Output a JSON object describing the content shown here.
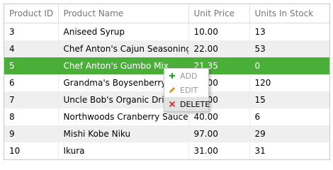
{
  "grid": {
    "columns": [
      "Product ID",
      "Product Name",
      "Unit Price",
      "Units In Stock"
    ],
    "rows": [
      [
        "3",
        "Aniseed Syrup",
        "10.00",
        "13"
      ],
      [
        "4",
        "Chef Anton's Cajun Seasoning",
        "22.00",
        "53"
      ],
      [
        "5",
        "Chef Anton's Gumbo Mix",
        "21.35",
        "0"
      ],
      [
        "6",
        "Grandma's Boysenberry Spread",
        "25.00",
        "120"
      ],
      [
        "7",
        "Uncle Bob's Organic Dried Pears",
        "30.00",
        "15"
      ],
      [
        "8",
        "Northwoods Cranberry Sauce",
        "40.00",
        "6"
      ],
      [
        "9",
        "Mishi Kobe Niku",
        "97.00",
        "29"
      ],
      [
        "10",
        "Ikura",
        "31.00",
        "31"
      ]
    ],
    "selected_row": 2
  },
  "context_menu": {
    "items": [
      {
        "label": "ADD",
        "icon": "plus-icon",
        "color": "#2e9e2e"
      },
      {
        "label": "EDIT",
        "icon": "pencil-icon",
        "color": "#e0a020"
      },
      {
        "label": "DELETE",
        "icon": "close-icon",
        "color": "#d42a2a"
      }
    ],
    "active_index": 2
  },
  "colors": {
    "selection": "#4aaf39",
    "alt_row": "#efefef"
  }
}
